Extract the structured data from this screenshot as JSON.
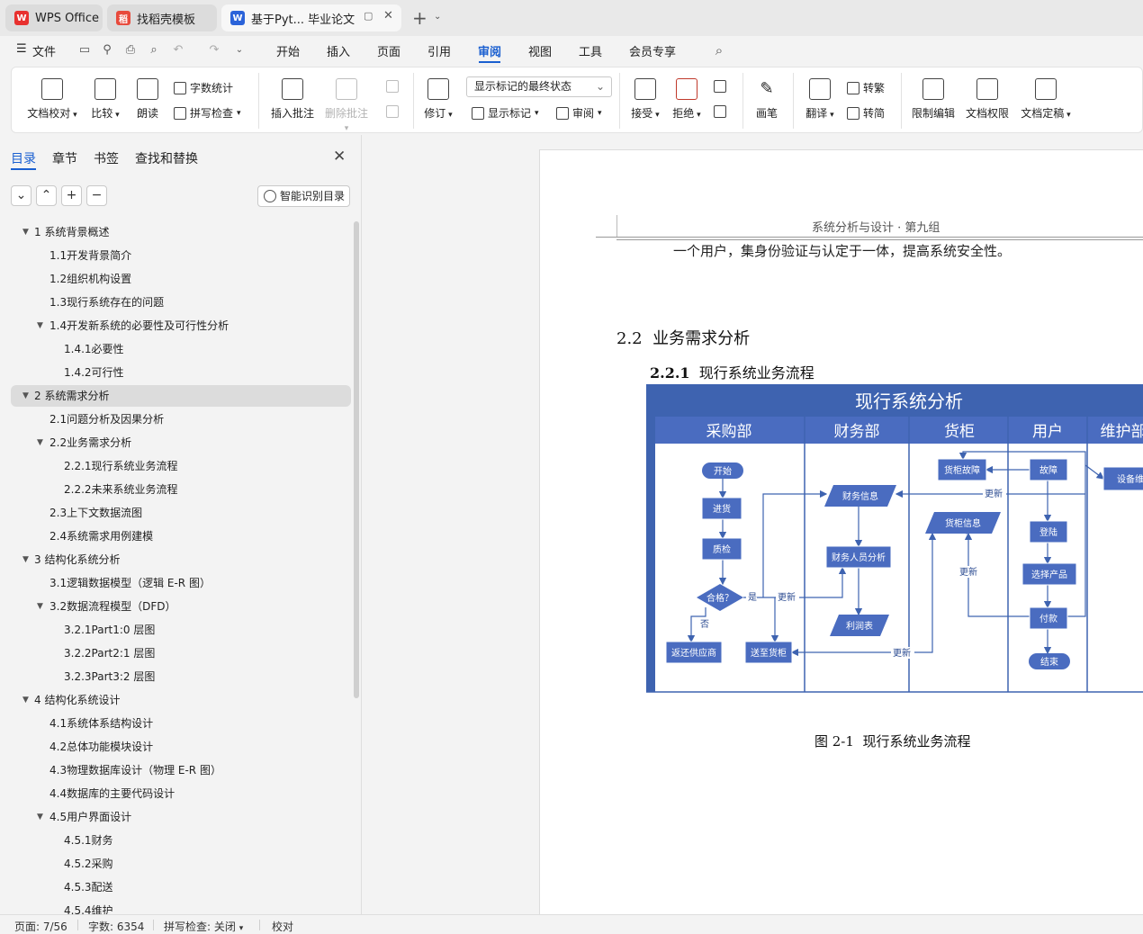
{
  "titlebar": {
    "tabs": [
      {
        "label": "WPS Office",
        "icon": "wps-logo-icon",
        "color": "#e8312f"
      },
      {
        "label": "找稻壳模板",
        "icon": "docer-icon",
        "color": "#e84a3c"
      },
      {
        "label": "基于Pyt... 毕业论文",
        "icon": "writer-icon",
        "color": "#2b63d9"
      }
    ],
    "new_tab": "+"
  },
  "menubar": {
    "file_label": "文件",
    "tabs": [
      "开始",
      "插入",
      "页面",
      "引用",
      "审阅",
      "视图",
      "工具",
      "会员专享"
    ],
    "active_tab": "审阅"
  },
  "ribbon": {
    "doc_check": "文档校对",
    "compare": "比较",
    "read_aloud": "朗读",
    "word_count": "字数统计",
    "spell_check": "拼写检查",
    "insert_comment": "插入批注",
    "delete_comment": "删除批注",
    "track_changes": "修订",
    "markup_select": "显示标记的最终状态",
    "show_markup": "显示标记",
    "review_pane": "审阅",
    "accept": "接受",
    "reject": "拒绝",
    "pen": "画笔",
    "translate": "翻译",
    "to_traditional": "转繁",
    "to_simplified": "转简",
    "restrict_edit": "限制编辑",
    "doc_permission": "文档权限",
    "doc_finalize": "文档定稿"
  },
  "nav": {
    "tabs": [
      "目录",
      "章节",
      "书签",
      "查找和替换"
    ],
    "active_tab": "目录",
    "smart_toc": "智能识别目录",
    "toc": [
      {
        "label": "1   系统背景概述",
        "level": 1,
        "expanded": true
      },
      {
        "label": "1.1开发背景简介",
        "level": 2
      },
      {
        "label": "1.2组织机构设置",
        "level": 2
      },
      {
        "label": "1.3现行系统存在的问题",
        "level": 2
      },
      {
        "label": "1.4开发新系统的必要性及可行性分析",
        "level": 2,
        "expanded": true
      },
      {
        "label": "1.4.1必要性",
        "level": 3
      },
      {
        "label": "1.4.2可行性",
        "level": 3
      },
      {
        "label": "2   系统需求分析",
        "level": 1,
        "expanded": true,
        "selected": true
      },
      {
        "label": "2.1问题分析及因果分析",
        "level": 2
      },
      {
        "label": "2.2业务需求分析",
        "level": 2,
        "expanded": true
      },
      {
        "label": "2.2.1现行系统业务流程",
        "level": 3
      },
      {
        "label": "2.2.2未来系统业务流程",
        "level": 3
      },
      {
        "label": "2.3上下文数据流图",
        "level": 2
      },
      {
        "label": "2.4系统需求用例建模",
        "level": 2
      },
      {
        "label": "3   结构化系统分析",
        "level": 1,
        "expanded": true
      },
      {
        "label": "3.1逻辑数据模型（逻辑 E-R 图）",
        "level": 2
      },
      {
        "label": "3.2数据流程模型（DFD）",
        "level": 2,
        "expanded": true
      },
      {
        "label": "3.2.1Part1:0 层图",
        "level": 3
      },
      {
        "label": "3.2.2Part2:1 层图",
        "level": 3
      },
      {
        "label": "3.2.3Part3:2 层图",
        "level": 3
      },
      {
        "label": "4   结构化系统设计",
        "level": 1,
        "expanded": true
      },
      {
        "label": "4.1系统体系结构设计",
        "level": 2
      },
      {
        "label": "4.2总体功能模块设计",
        "level": 2
      },
      {
        "label": "4.3物理数据库设计（物理 E-R 图）",
        "level": 2
      },
      {
        "label": "4.4数据库的主要代码设计",
        "level": 2
      },
      {
        "label": "4.5用户界面设计",
        "level": 2,
        "expanded": true
      },
      {
        "label": "4.5.1财务",
        "level": 3
      },
      {
        "label": "4.5.2采购",
        "level": 3
      },
      {
        "label": "4.5.3配送",
        "level": 3
      },
      {
        "label": "4.5.4维护",
        "level": 3
      }
    ]
  },
  "document": {
    "header": "系统分析与设计 · 第九组",
    "body_text": "一个用户，集身份验证与认定于一体，提高系统安全性。",
    "heading_2_2_num": "2.2",
    "heading_2_2": "业务需求分析",
    "heading_2_2_1_num": "2.2.1",
    "heading_2_2_1": "现行系统业务流程",
    "figure_caption_num": "图 2-1",
    "figure_caption": "现行系统业务流程",
    "diagram": {
      "title": "现行系统分析",
      "lanes": [
        "采购部",
        "财务部",
        "货柜",
        "用户",
        "维护部"
      ],
      "nodes": {
        "start": "开始",
        "purchase": "进货",
        "inspect": "质检",
        "qualified": "合格？",
        "return_supplier": "返还供应商",
        "send_cabinet": "送至货柜",
        "finance_info": "财务信息",
        "finance_analysis": "财务人员分析",
        "profit_table": "利润表",
        "cabinet_fault": "货柜故障",
        "cabinet_info": "货柜信息",
        "fault": "故障",
        "login": "登陆",
        "select_product": "选择产品",
        "pay": "付款",
        "end": "结束",
        "device_maintain": "设备维"
      },
      "edge_labels": {
        "yes": "是",
        "no": "否",
        "update": "更新"
      },
      "colors": {
        "band": "#3e63b0",
        "node": "#4a6cc0",
        "line": "#3e63b0"
      }
    }
  },
  "status": {
    "page": "页面: 7/56",
    "words": "字数: 6354",
    "spell": "拼写检查: 关闭",
    "proof": "校对"
  }
}
